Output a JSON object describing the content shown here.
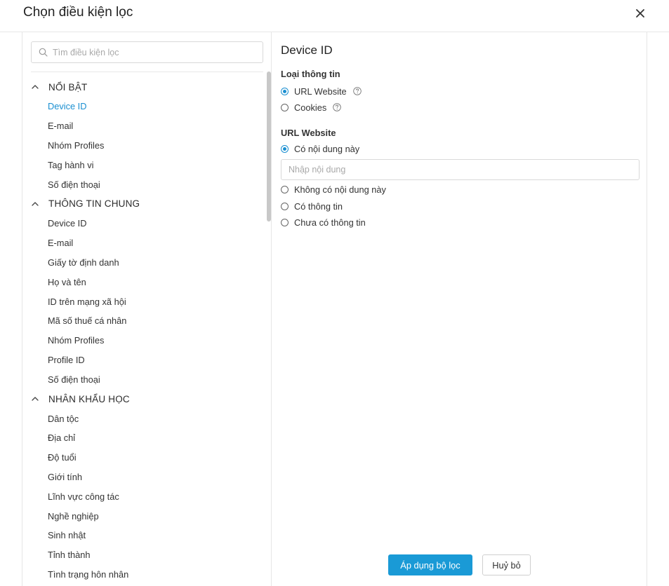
{
  "dialog": {
    "title": "Chọn điều kiện lọc",
    "close_icon": "close-icon"
  },
  "sidebar": {
    "search": {
      "placeholder": "Tìm điều kiện lọc",
      "value": "",
      "icon": "search-icon"
    },
    "groups": [
      {
        "label": "NỔI BẬT",
        "expanded": true,
        "items": [
          "Device ID",
          "E-mail",
          "Nhóm Profiles",
          "Tag hành vi",
          "Số điện thoại"
        ]
      },
      {
        "label": "THÔNG TIN CHUNG",
        "expanded": true,
        "items": [
          "Device ID",
          "E-mail",
          "Giấy tờ định danh",
          "Họ và tên",
          "ID trên mạng xã hội",
          "Mã số thuế cá nhân",
          "Nhóm Profiles",
          "Profile ID",
          "Số điện thoại"
        ]
      },
      {
        "label": "NHÂN KHẨU HỌC",
        "expanded": true,
        "items": [
          "Dân tộc",
          "Địa chỉ",
          "Độ tuổi",
          "Giới tính",
          "Lĩnh vực công tác",
          "Nghề nghiệp",
          "Sinh nhật",
          "Tỉnh thành",
          "Tình trạng hôn nhân"
        ]
      }
    ],
    "active": {
      "group": 0,
      "item": 0
    }
  },
  "detail": {
    "title": "Device ID",
    "info_type": {
      "label": "Loại thông tin",
      "options": [
        {
          "label": "URL Website",
          "selected": true,
          "help_icon": "help-icon"
        },
        {
          "label": "Cookies",
          "selected": false,
          "help_icon": "help-icon"
        }
      ]
    },
    "url_section": {
      "label": "URL Website",
      "options": [
        {
          "label": "Có nội dung này",
          "selected": true
        },
        {
          "label": "Không có nội dung này",
          "selected": false
        },
        {
          "label": "Có thông tin",
          "selected": false
        },
        {
          "label": "Chưa có thông tin",
          "selected": false
        }
      ],
      "input_placeholder": "Nhập nội dung",
      "input_value": ""
    }
  },
  "footer": {
    "apply_label": "Áp dụng bộ lọc",
    "cancel_label": "Huỷ bỏ"
  },
  "colors": {
    "accent": "#1a9ad6",
    "active_text": "#1a8fd1",
    "border": "#e6e6e6"
  }
}
